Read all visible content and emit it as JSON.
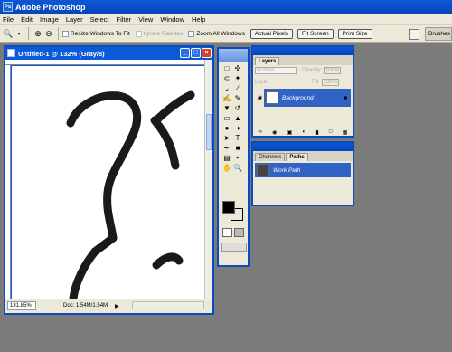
{
  "app": {
    "title": "Adobe Photoshop",
    "logo": "Ps"
  },
  "menu": [
    "File",
    "Edit",
    "Image",
    "Layer",
    "Select",
    "Filter",
    "View",
    "Window",
    "Help"
  ],
  "options_bar": {
    "resize_windows": "Resize Windows To Fit",
    "ignore_palettes": "Ignore Palettes",
    "zoom_all": "Zoom All Windows",
    "actual_pixels": "Actual Pixels",
    "fit_screen": "Fit Screen",
    "print_size": "Print Size",
    "brushes_tab": "Brushes"
  },
  "document": {
    "title": "Untitled-1 @ 132% (Gray/8)",
    "zoom": "131.85%",
    "doc_size": "Doc: 1.54M/1.54M"
  },
  "layers": {
    "tab": "Layers",
    "blend_mode": "Normal",
    "opacity_label": "Opacity:",
    "opacity_value": "100%",
    "lock_label": "Lock:",
    "fill_label": "Fill:",
    "fill_value": "100%",
    "layer_name": "Background"
  },
  "paths": {
    "tab_channels": "Channels",
    "tab_paths": "Paths",
    "path_name": "Work Path"
  },
  "colors": {
    "foreground": "#000000",
    "background": "#ffffff",
    "titlebar": "#0a58d8",
    "selection": "#3163c5"
  }
}
